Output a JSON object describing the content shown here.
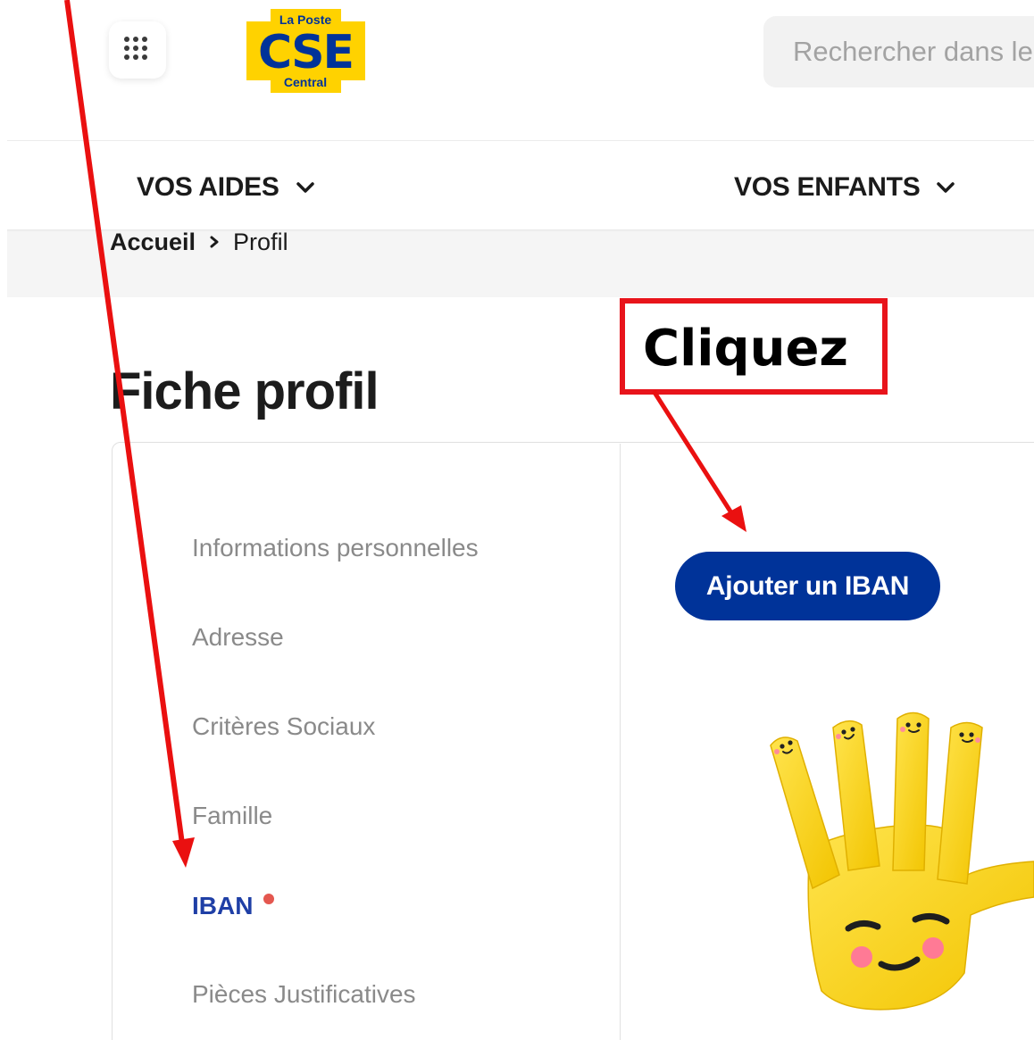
{
  "header": {
    "apps_icon": "grid-dots-icon",
    "logo": {
      "top": "La Poste",
      "main": "CSE",
      "bottom": "Central",
      "colors": {
        "yellow": "#ffd200",
        "blue": "#003399"
      }
    },
    "search": {
      "placeholder": "Rechercher dans le"
    }
  },
  "nav": {
    "items": [
      {
        "label": "VOS AIDES",
        "icon": "chevron-down-icon"
      },
      {
        "label": "VOS ENFANTS",
        "icon": "chevron-down-icon"
      }
    ]
  },
  "breadcrumb": {
    "home": "Accueil",
    "separator_icon": "chevron-right-icon",
    "current": "Profil"
  },
  "page": {
    "title": "Fiche profil"
  },
  "profile_menu": {
    "items": [
      {
        "label": "Informations personnelles",
        "active": false
      },
      {
        "label": "Adresse",
        "active": false
      },
      {
        "label": "Critères Sociaux",
        "active": false
      },
      {
        "label": "Famille",
        "active": false
      },
      {
        "label": "IBAN",
        "active": true,
        "badge": "notification-dot"
      },
      {
        "label": "Pièces Justificatives",
        "active": false
      }
    ]
  },
  "main": {
    "add_iban_label": "Ajouter un IBAN",
    "illustration": "smiling-hand-illustration"
  },
  "annotation": {
    "callout_text": "Cliquez",
    "color": "#e8141b"
  },
  "colors": {
    "primary": "#003399",
    "active_menu": "#1f3fa6",
    "badge": "#e4574f",
    "annotation": "#e8141b"
  }
}
